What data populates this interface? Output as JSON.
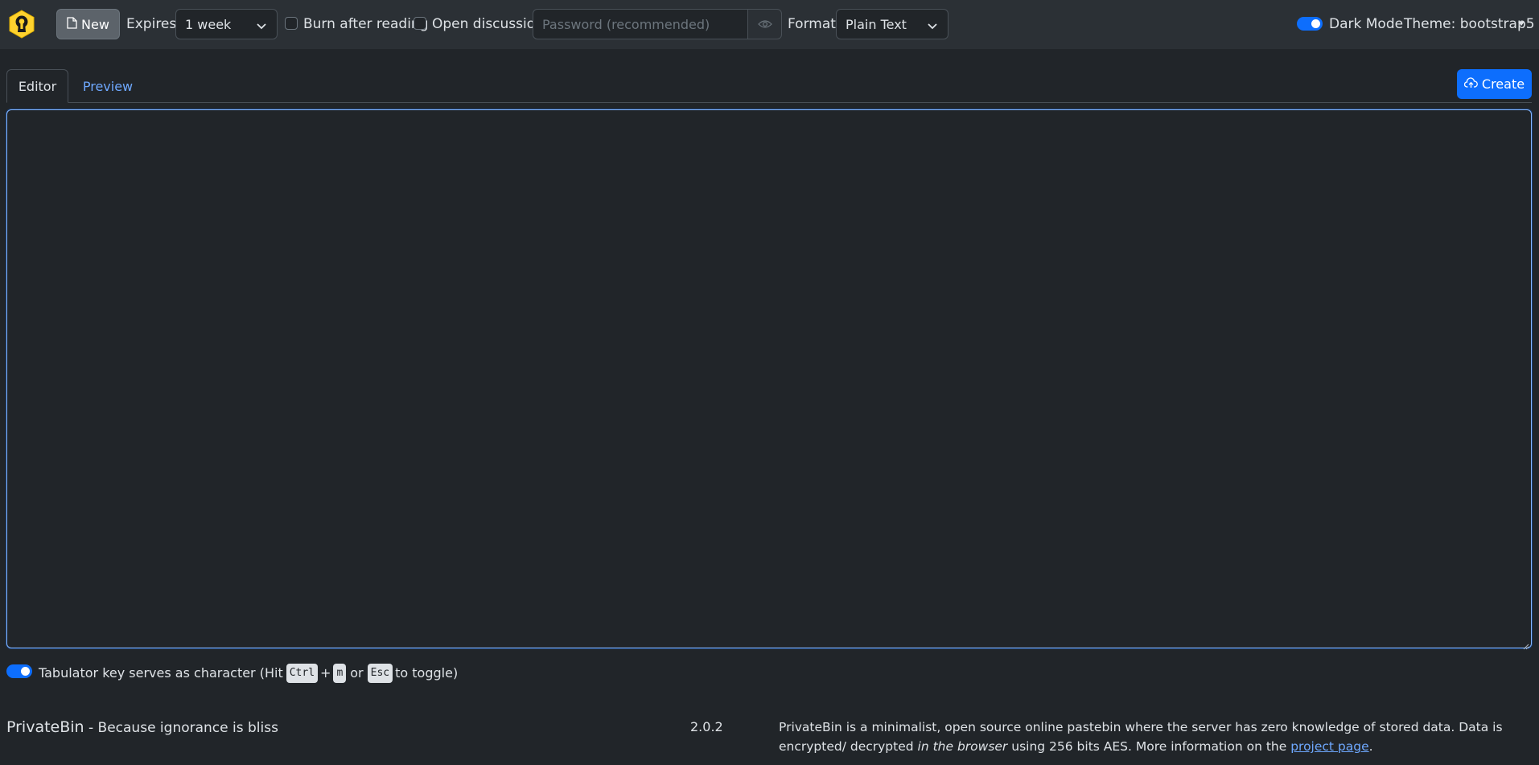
{
  "navbar": {
    "new_label": "New",
    "expires_label": "Expires:",
    "expires_value": "1 week",
    "burn_label": "Burn after reading",
    "discussion_label": "Open discussion",
    "password_placeholder": "Password (recommended)",
    "format_label": "Format:",
    "format_value": "Plain Text",
    "dark_mode_label": "Dark Mode",
    "theme_label": "Theme: bootstrap5"
  },
  "tabs": {
    "editor": "Editor",
    "preview": "Preview",
    "create_label": "Create"
  },
  "editor": {
    "value": ""
  },
  "tab_hint": {
    "prefix": "Tabulator key serves as character (Hit",
    "key1": "Ctrl",
    "plus": "+",
    "key2": "m",
    "or": "or",
    "key3": "Esc",
    "suffix": "to toggle)"
  },
  "footer": {
    "app_name": "PrivateBin",
    "tagline": " - Because ignorance is bliss",
    "version": "2.0.2",
    "about_1": "PrivateBin is a minimalist, open source online pastebin where the server has zero knowledge of stored data. Data is encrypted/ decrypted ",
    "about_em": "in the browser",
    "about_2": " using 256 bits AES. More information on the ",
    "about_link": "project page",
    "about_end": "."
  },
  "colors": {
    "background": "#212529",
    "navbar": "#2b3035",
    "accent": "#0d6efd",
    "link": "#6ea8fe",
    "logo": "#ffd700"
  },
  "icons": [
    "privatebin-logo-icon",
    "file-icon",
    "chevron-down-icon",
    "eye-icon",
    "cloud-upload-icon",
    "caret-down-icon",
    "resize-grip-icon"
  ]
}
